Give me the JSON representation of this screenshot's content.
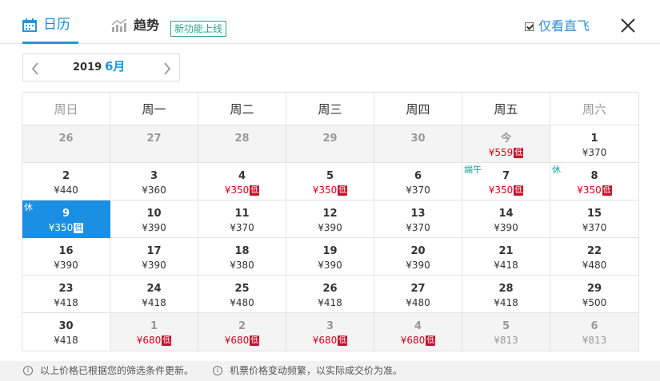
{
  "header": {
    "calendar_tab": "日历",
    "trend_tab": "趋势",
    "new_badge": "新功能上线",
    "direct_only": "仅看直飞"
  },
  "month_nav": {
    "year": "2019",
    "month": "6月"
  },
  "weekdays": [
    "周日",
    "周一",
    "周二",
    "周三",
    "周四",
    "周五",
    "周六"
  ],
  "low_label": "低",
  "colors": {
    "accent": "#1a8fe3",
    "low_price": "#d0021b",
    "holiday": "#14a19a"
  },
  "calendar": [
    {
      "day": "26",
      "other": true
    },
    {
      "day": "27",
      "other": true
    },
    {
      "day": "28",
      "other": true
    },
    {
      "day": "29",
      "other": true
    },
    {
      "day": "30",
      "other": true
    },
    {
      "day": "今",
      "price": "¥559",
      "low": true,
      "other": true
    },
    {
      "day": "1",
      "price": "¥370"
    },
    {
      "day": "2",
      "price": "¥440"
    },
    {
      "day": "3",
      "price": "¥360"
    },
    {
      "day": "4",
      "price": "¥350",
      "low": true
    },
    {
      "day": "5",
      "price": "¥350",
      "low": true
    },
    {
      "day": "6",
      "price": "¥370"
    },
    {
      "day": "7",
      "price": "¥350",
      "low": true,
      "holiday": "端午"
    },
    {
      "day": "8",
      "price": "¥350",
      "low": true,
      "holiday": "休"
    },
    {
      "day": "9",
      "price": "¥350",
      "low": true,
      "holiday": "休",
      "selected": true
    },
    {
      "day": "10",
      "price": "¥390"
    },
    {
      "day": "11",
      "price": "¥370"
    },
    {
      "day": "12",
      "price": "¥390"
    },
    {
      "day": "13",
      "price": "¥370"
    },
    {
      "day": "14",
      "price": "¥390"
    },
    {
      "day": "15",
      "price": "¥370"
    },
    {
      "day": "16",
      "price": "¥390"
    },
    {
      "day": "17",
      "price": "¥390"
    },
    {
      "day": "18",
      "price": "¥380"
    },
    {
      "day": "19",
      "price": "¥390"
    },
    {
      "day": "20",
      "price": "¥390"
    },
    {
      "day": "21",
      "price": "¥418"
    },
    {
      "day": "22",
      "price": "¥480"
    },
    {
      "day": "23",
      "price": "¥418"
    },
    {
      "day": "24",
      "price": "¥418"
    },
    {
      "day": "25",
      "price": "¥480"
    },
    {
      "day": "26",
      "price": "¥418"
    },
    {
      "day": "27",
      "price": "¥480"
    },
    {
      "day": "28",
      "price": "¥418"
    },
    {
      "day": "29",
      "price": "¥500"
    },
    {
      "day": "30",
      "price": "¥418"
    },
    {
      "day": "1",
      "price": "¥680",
      "low": true,
      "other": true
    },
    {
      "day": "2",
      "price": "¥680",
      "low": true,
      "other": true
    },
    {
      "day": "3",
      "price": "¥680",
      "low": true,
      "other": true
    },
    {
      "day": "4",
      "price": "¥680",
      "low": true,
      "other": true
    },
    {
      "day": "5",
      "price": "¥813",
      "other": true
    },
    {
      "day": "6",
      "price": "¥813",
      "other": true
    }
  ],
  "footer": {
    "note1": "以上价格已根据您的筛选条件更新。",
    "note2": "机票价格变动频繁，以实际成交价为准。"
  }
}
